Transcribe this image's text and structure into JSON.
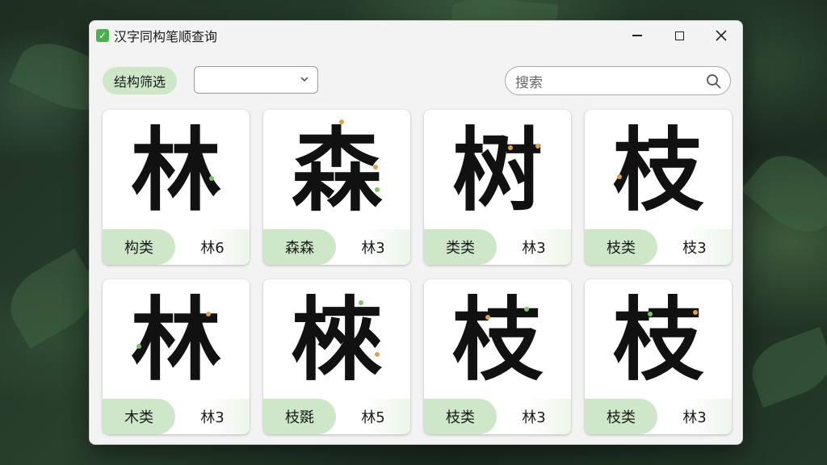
{
  "window": {
    "title": "汉字同构笔顺查询"
  },
  "toolbar": {
    "filter_label": "结构筛选",
    "select_value": "",
    "search_placeholder": "搜索"
  },
  "cards": [
    {
      "char": "林",
      "tag": "构类",
      "strokes": "林6"
    },
    {
      "char": "森",
      "tag": "森森",
      "strokes": "林3"
    },
    {
      "char": "树",
      "tag": "类类",
      "strokes": "林3"
    },
    {
      "char": "枝",
      "tag": "枝类",
      "strokes": "枝3"
    },
    {
      "char": "林",
      "tag": "木类",
      "strokes": "林3"
    },
    {
      "char": "棶",
      "tag": "枝毲",
      "strokes": "林5"
    },
    {
      "char": "枝",
      "tag": "枝类",
      "strokes": "林3"
    },
    {
      "char": "枝",
      "tag": "枝类",
      "strokes": "林3"
    }
  ],
  "colors": {
    "accent_green": "#cde7c8",
    "app_icon": "#4caf50",
    "stroke_hint_green": "#7cc36a",
    "stroke_hint_orange": "#e0a050"
  },
  "icons": {
    "app": "checkmark-icon",
    "minimize": "minimize-icon",
    "maximize": "maximize-icon",
    "close": "close-icon",
    "dropdown": "chevron-down-icon",
    "search": "search-icon"
  }
}
